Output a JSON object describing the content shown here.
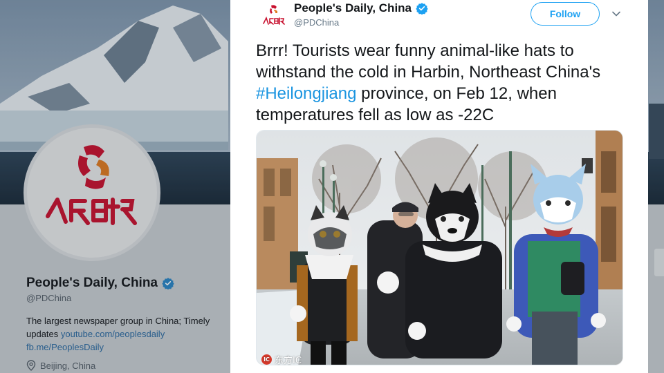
{
  "profile": {
    "name": "People's Daily, China",
    "handle": "@PDChina",
    "bio_text": "The largest newspaper group in China; Timely updates ",
    "bio_link1": "youtube.com/peoplesdaily",
    "bio_link2": "fb.me/PeoplesDaily",
    "location": "Beijing, China",
    "logo_text": "人民日报",
    "brand_color": "#c8102e"
  },
  "tweet": {
    "name": "People's Daily, China",
    "handle": "@PDChina",
    "follow_label": "Follow",
    "text_before": "Brrr! Tourists wear funny animal-like hats to withstand the cold in Harbin, Northeast China's ",
    "hashtag": "#Heilongjiang",
    "text_after": " province, on Feb 12, when temperatures fell as low as -22C",
    "photo_watermark": "东方IC",
    "watermark_badge": "IC",
    "accent_color": "#1da1f2"
  },
  "icons": [
    "verified-badge-icon",
    "chevron-down-icon",
    "location-pin-icon",
    "peoples-daily-logo"
  ]
}
